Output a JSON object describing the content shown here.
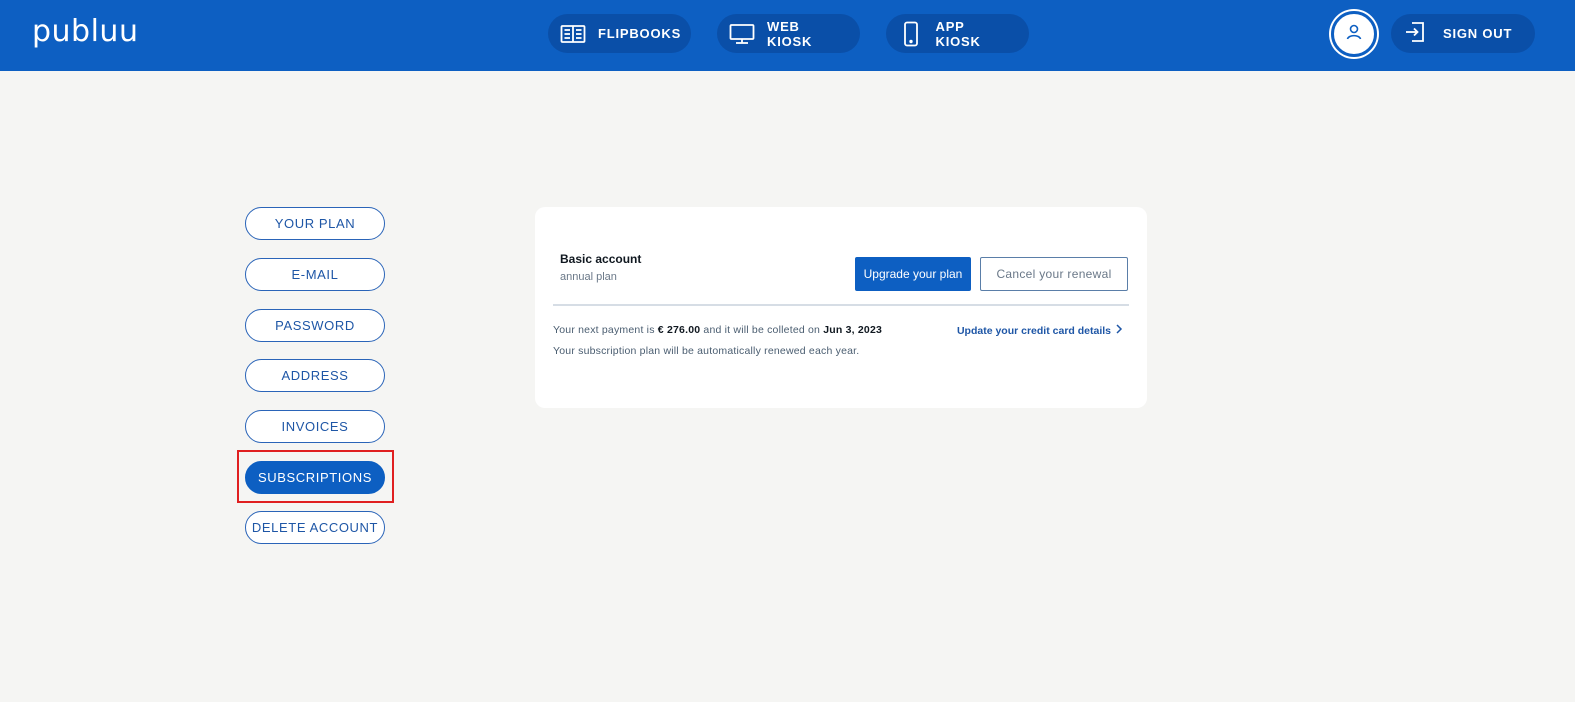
{
  "header": {
    "logo": "publuu",
    "nav": [
      {
        "label": "FLIPBOOKS",
        "icon": "book-icon"
      },
      {
        "label": "WEB KIOSK",
        "icon": "monitor-icon"
      },
      {
        "label": "APP KIOSK",
        "icon": "phone-icon"
      }
    ],
    "sign_out_label": "SIGN OUT",
    "avatar_icon": "user-icon",
    "sign_out_icon": "sign-out-icon",
    "accent": "#0d5fc2"
  },
  "sidebar": {
    "items": [
      {
        "label": "YOUR PLAN",
        "active": false
      },
      {
        "label": "E-MAIL",
        "active": false
      },
      {
        "label": "PASSWORD",
        "active": false
      },
      {
        "label": "ADDRESS",
        "active": false
      },
      {
        "label": "INVOICES",
        "active": false
      },
      {
        "label": "SUBSCRIPTIONS",
        "active": true
      },
      {
        "label": "DELETE ACCOUNT",
        "active": false
      }
    ],
    "highlight_color": "#e02020"
  },
  "subscription": {
    "plan_title": "Basic account",
    "plan_sub": "annual plan",
    "upgrade_label": "Upgrade your plan",
    "cancel_label": "Cancel your renewal",
    "payment_prefix": "Your next payment is",
    "payment_amount": "€ 276.00",
    "payment_middle": "and it will be colleted on",
    "payment_date": "Jun 3, 2023",
    "renew_text": "Your subscription plan will be automatically renewed each year.",
    "credit_card_link": "Update your credit card details",
    "credit_card_link_icon": "chevron-right-icon"
  }
}
